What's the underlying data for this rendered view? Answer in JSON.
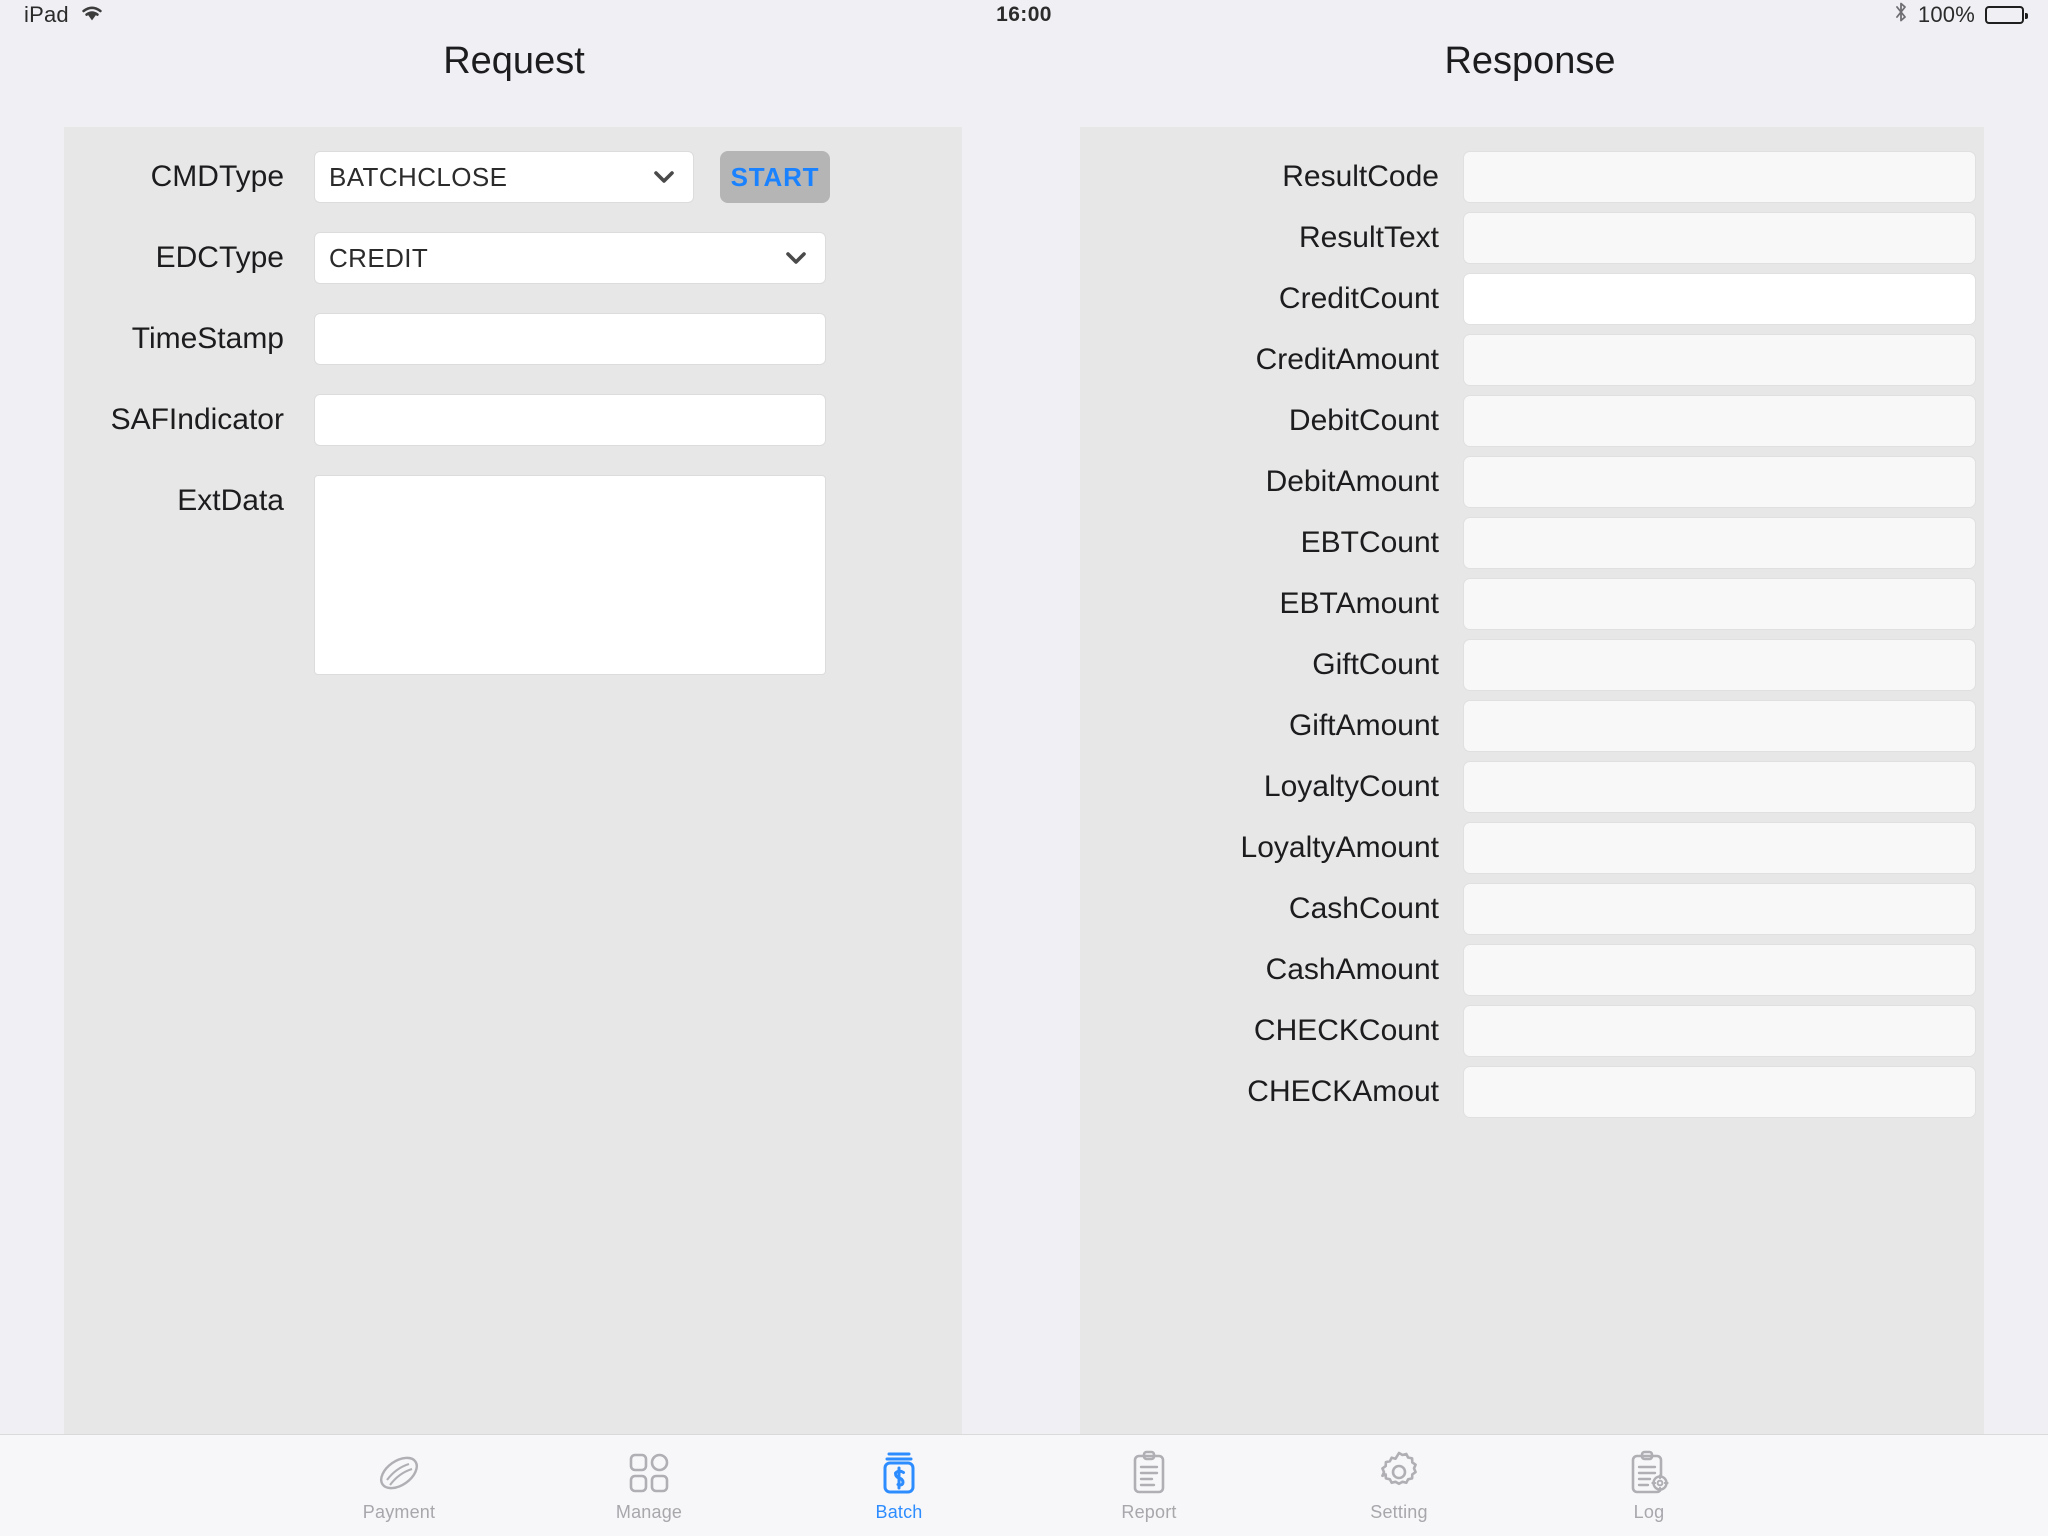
{
  "status_bar": {
    "device": "iPad",
    "wifi_icon": "wifi-icon",
    "time": "16:00",
    "bluetooth_icon": "bluetooth-icon",
    "battery_percent": "100%",
    "battery_icon": "battery-full-icon"
  },
  "panels": {
    "request_title": "Request",
    "response_title": "Response"
  },
  "request": {
    "rows": [
      {
        "label": "CMDType",
        "type": "select",
        "value": "BATCHCLOSE",
        "icon": "chevron-down-icon"
      },
      {
        "label": "EDCType",
        "type": "select",
        "value": "CREDIT",
        "icon": "chevron-down-icon"
      },
      {
        "label": "TimeStamp",
        "type": "input",
        "value": "",
        "placeholder": ""
      },
      {
        "label": "SAFIndicator",
        "type": "input",
        "value": "",
        "placeholder": ""
      },
      {
        "label": "ExtData",
        "type": "textarea",
        "value": "",
        "placeholder": ""
      }
    ],
    "start_button": "START"
  },
  "response": {
    "rows": [
      {
        "label": "ResultCode",
        "value": ""
      },
      {
        "label": "ResultText",
        "value": ""
      },
      {
        "label": "CreditCount",
        "value": ""
      },
      {
        "label": "CreditAmount",
        "value": ""
      },
      {
        "label": "DebitCount",
        "value": ""
      },
      {
        "label": "DebitAmount",
        "value": ""
      },
      {
        "label": "EBTCount",
        "value": ""
      },
      {
        "label": "EBTAmount",
        "value": ""
      },
      {
        "label": "GiftCount",
        "value": ""
      },
      {
        "label": "GiftAmount",
        "value": ""
      },
      {
        "label": "LoyaltyCount",
        "value": ""
      },
      {
        "label": "LoyaltyAmount",
        "value": ""
      },
      {
        "label": "CashCount",
        "value": ""
      },
      {
        "label": "CashAmount",
        "value": ""
      },
      {
        "label": "CHECKCount",
        "value": ""
      },
      {
        "label": "CHECKAmout",
        "value": ""
      }
    ]
  },
  "tab_bar": {
    "items": [
      {
        "label": "Payment",
        "icon": "payment-coin-icon",
        "active": false
      },
      {
        "label": "Manage",
        "icon": "grid-squares-icon",
        "active": false
      },
      {
        "label": "Batch",
        "icon": "batch-jar-dollar-icon",
        "active": true
      },
      {
        "label": "Report",
        "icon": "clipboard-lines-icon",
        "active": false
      },
      {
        "label": "Setting",
        "icon": "gear-icon",
        "active": false
      },
      {
        "label": "Log",
        "icon": "clipboard-gear-icon",
        "active": false
      }
    ]
  },
  "colors": {
    "page_background": "#EFEFF4",
    "panel_background": "#E7E7E7",
    "accent_blue": "#2D8CFF",
    "start_text": "#1A82FF",
    "start_background": "#B5B5B5",
    "inactive_tab": "#A7A7AC"
  }
}
